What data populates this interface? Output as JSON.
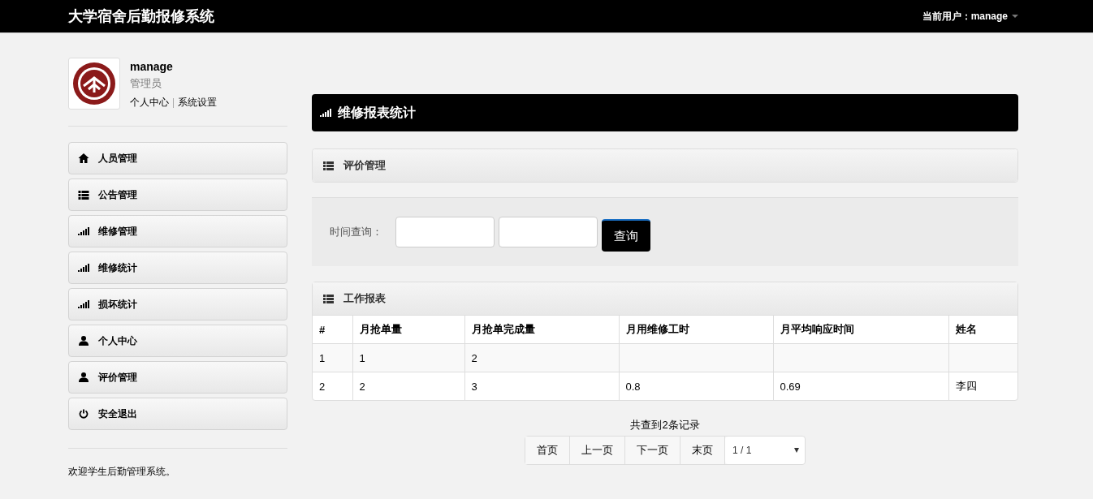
{
  "navbar": {
    "title": "大学宿舍后勤报修系统",
    "user_menu": "当前用户：manage"
  },
  "profile": {
    "name": "manage",
    "role": "管理员",
    "links": [
      "个人中心",
      "系统设置"
    ]
  },
  "menu": [
    {
      "label": "人员管理"
    },
    {
      "label": "公告管理"
    },
    {
      "label": "维修管理"
    },
    {
      "label": "维修统计"
    },
    {
      "label": "损坏统计"
    },
    {
      "label": "个人中心"
    },
    {
      "label": "评价管理"
    },
    {
      "label": "安全退出"
    }
  ],
  "footer": "欢迎学生后勤管理系统。",
  "page_header": "维修报表统计",
  "filter_panel": {
    "title": "评价管理",
    "label": "时间查询：",
    "button": "查询"
  },
  "report": {
    "title": "工作报表",
    "columns": [
      "#",
      "月抢单量",
      "月抢单完成量",
      "月用维修工时",
      "月平均响应时间",
      "姓名"
    ],
    "rows": [
      [
        "1",
        "1",
        "2",
        null,
        null,
        null
      ],
      [
        "2",
        "2",
        "3",
        "0.8",
        "0.69",
        "李四"
      ]
    ]
  },
  "pagination": {
    "summary": "共查到2条记录",
    "buttons": [
      "首页",
      "上一页",
      "下一页",
      "末页"
    ],
    "page_select": "1 / 1"
  }
}
